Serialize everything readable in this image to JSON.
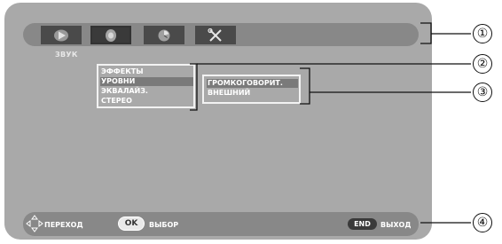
{
  "menu": {
    "title": "ЗВУК",
    "items": [
      {
        "label": "ЭФФЕКТЫ",
        "selected": false
      },
      {
        "label": "УРОВНИ",
        "selected": true
      },
      {
        "label": "ЭКВАЛАЙЗ.",
        "selected": false
      },
      {
        "label": "СТЕРЕО",
        "selected": false
      }
    ]
  },
  "submenu": {
    "items": [
      {
        "label": "ГРОМКОГОВОРИТ.",
        "selected": true
      },
      {
        "label": "ВНЕШНИЙ",
        "selected": false
      }
    ]
  },
  "tabs": [
    {
      "icon": "picture-icon"
    },
    {
      "icon": "sound-icon",
      "selected": true
    },
    {
      "icon": "timer-icon"
    },
    {
      "icon": "tools-icon"
    }
  ],
  "bottom": {
    "navigate_label": "ПЕРЕХОД",
    "ok_key": "OK",
    "select_label": "ВЫБОР",
    "end_key": "END",
    "exit_label": "ВЫХОД"
  },
  "callouts": [
    "①",
    "②",
    "③",
    "④"
  ],
  "colors": {
    "screen_bg": "#a9a9a9",
    "bar_bg": "#888888",
    "highlight": "#7a7a7a",
    "frame": "#f2f2f2"
  }
}
